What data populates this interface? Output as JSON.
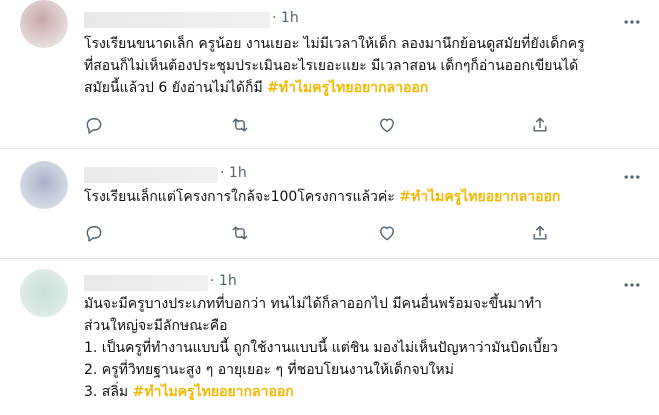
{
  "tweets": [
    {
      "time": "1h",
      "text_lines": [
        "โรงเรียนขนาดเล็ก ครูน้อย งานเยอะ ไม่มีเวลาให้เด็ก ลองมานึกย้อนดูสมัยที่ยังเด็กครู",
        "ที่สอนก็ไม่เห็นต้องประชุมประเมินอะไรเยอะแยะ มีเวลาสอน เด็กๆก็อ่านออกเขียนได้",
        "สมัยนี้แล้วป 6 ยังอ่านไม่ได้ก็มี"
      ],
      "hashtag": "#ทำไมครูไทยอยากลาออก"
    },
    {
      "time": "1h",
      "text_lines": [
        "โรงเรียนเล็กแต่โครงการใกล้จะ100โครงการแล้วค่ะ"
      ],
      "hashtag": "#ทำไมครูไทยอยากลาออก"
    },
    {
      "time": "1h",
      "text_lines": [
        "มันจะมีครูบางประเภทที่บอกว่า ทนไม่ได้ก็ลาออกไป มีคนอื่นพร้อมจะขึ้นมาทำ",
        "ส่วนใหญ่จะมีลักษณะคือ",
        "1. เป็นครูที่ทำงานแบบนี้ ถูกใช้งานแบบนี้ แต่ชิน มองไม่เห็นปัญหาว่ามันบิดเบี้ยว",
        "2. ครูที่วิทยฐานะสูง ๆ อายุเยอะ ๆ ที่ชอบโยนงานให้เด็กจบใหม่",
        "3. สลิ่ม"
      ],
      "hashtag": "#ทำไมครูไทยอยากลาออก"
    }
  ],
  "colors": {
    "hashtag": "#f4b800",
    "icon": "#536471",
    "divider": "#e1e6ea"
  },
  "icons": [
    "reply-icon",
    "retweet-icon",
    "like-icon",
    "share-icon",
    "more-icon"
  ]
}
